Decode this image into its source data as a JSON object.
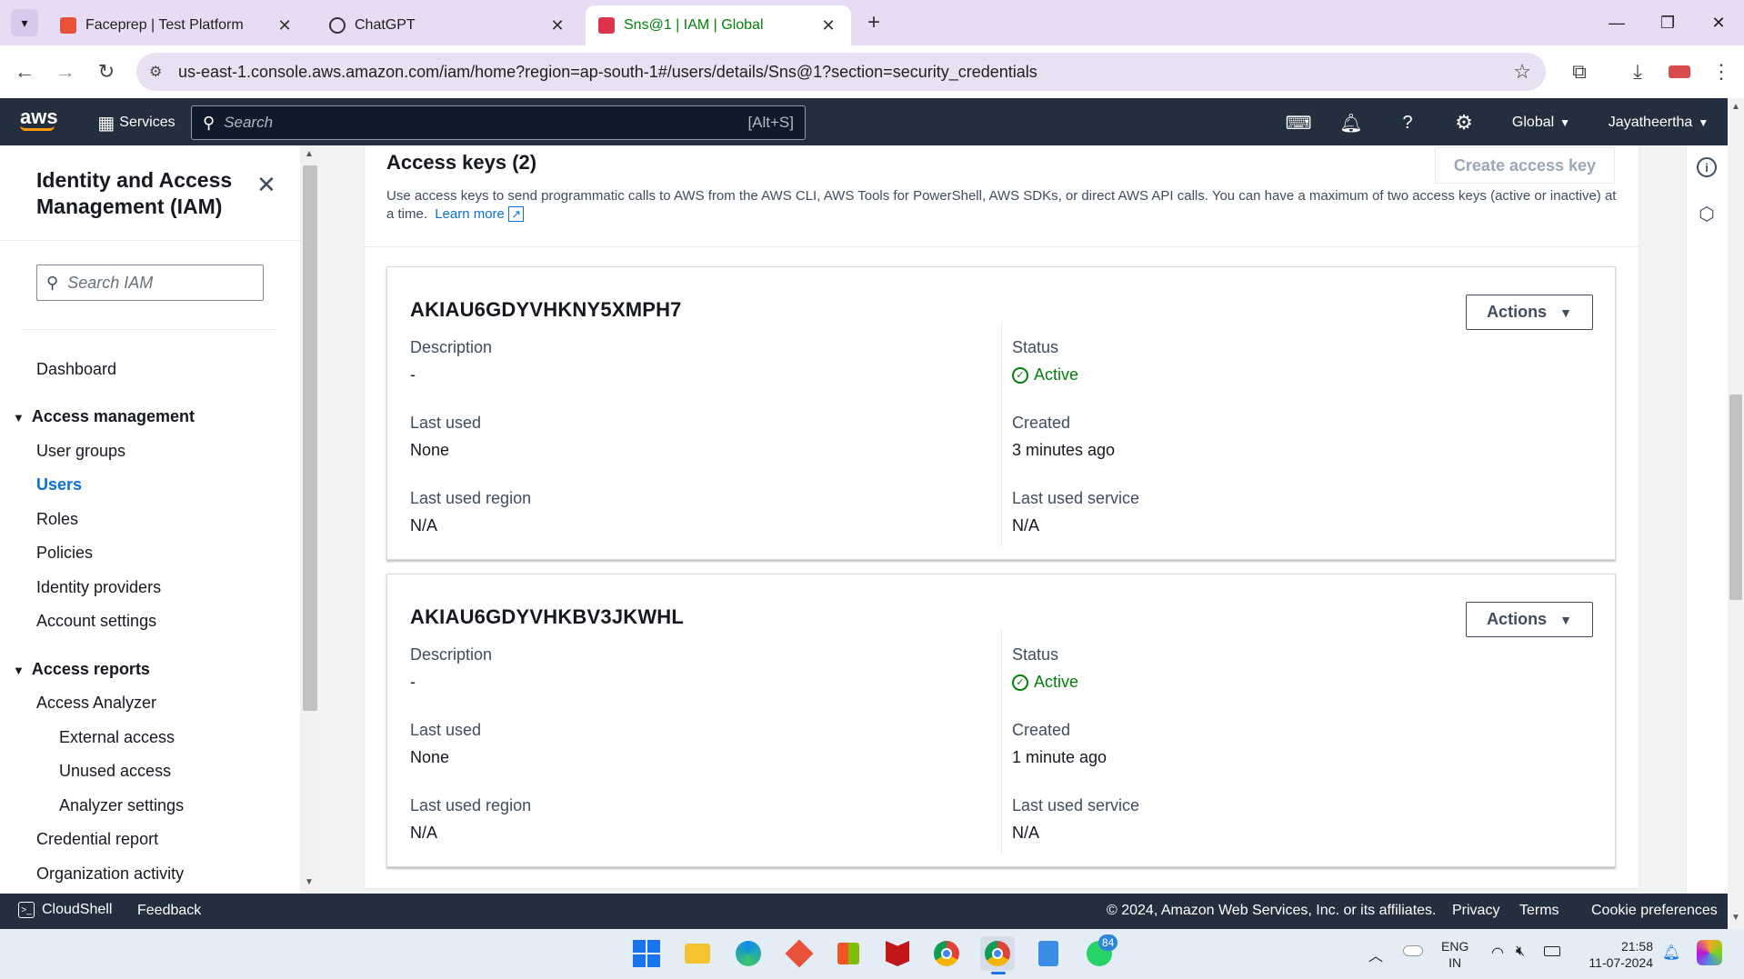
{
  "browser": {
    "tabs": [
      {
        "title": "Faceprep | Test Platform",
        "favicon": "faceprep-icon",
        "color": "#e8523a"
      },
      {
        "title": "ChatGPT",
        "favicon": "chatgpt-icon",
        "color": "#333333"
      },
      {
        "title": "Sns@1 | IAM | Global",
        "favicon": "aws-iam-icon",
        "color": "#dd344c"
      }
    ],
    "url": "us-east-1.console.aws.amazon.com/iam/home?region=ap-south-1#/users/details/Sns@1?section=security_credentials"
  },
  "aws_header": {
    "logo": "aws",
    "services_label": "Services",
    "search_placeholder": "Search",
    "search_shortcut": "[Alt+S]",
    "region_label": "Global",
    "account_label": "Jayatheertha"
  },
  "sidebar": {
    "title": "Identity and Access Management (IAM)",
    "search_placeholder": "Search IAM",
    "dashboard": "Dashboard",
    "access_management": {
      "heading": "Access management",
      "items": [
        "User groups",
        "Users",
        "Roles",
        "Policies",
        "Identity providers",
        "Account settings"
      ],
      "selected": "Users"
    },
    "access_reports": {
      "heading": "Access reports",
      "items": [
        "Access Analyzer",
        "External access",
        "Unused access",
        "Analyzer settings",
        "Credential report",
        "Organization activity"
      ]
    }
  },
  "access_keys": {
    "heading": "Access keys (2)",
    "create_button": "Create access key",
    "description": "Use access keys to send programmatic calls to AWS from the AWS CLI, AWS Tools for PowerShell, AWS SDKs, or direct AWS API calls. You can have a maximum of two access keys (active or inactive) at a time.",
    "learn_more": "Learn more",
    "labels": {
      "description": "Description",
      "status": "Status",
      "last_used": "Last used",
      "created": "Created",
      "last_used_region": "Last used region",
      "last_used_service": "Last used service"
    },
    "actions_label": "Actions",
    "keys": [
      {
        "id": "AKIAU6GDYVHKNY5XMPH7",
        "description": "-",
        "status": "Active",
        "last_used": "None",
        "created": "3 minutes ago",
        "last_used_region": "N/A",
        "last_used_service": "N/A"
      },
      {
        "id": "AKIAU6GDYVHKBV3JKWHL",
        "description": "-",
        "status": "Active",
        "last_used": "None",
        "created": "1 minute ago",
        "last_used_region": "N/A",
        "last_used_service": "N/A"
      }
    ]
  },
  "footer": {
    "cloudshell": "CloudShell",
    "feedback": "Feedback",
    "copyright": "© 2024, Amazon Web Services, Inc. or its affiliates.",
    "privacy": "Privacy",
    "terms": "Terms",
    "cookie": "Cookie preferences"
  },
  "taskbar": {
    "language_top": "ENG",
    "language_bottom": "IN",
    "time": "21:58",
    "date": "11-07-2024",
    "whatsapp_badge": "84"
  },
  "colors": {
    "aws_header": "#232f3e",
    "link": "#0972d3",
    "active_green": "#037f0c",
    "tab_strip": "#e8dcf4"
  }
}
